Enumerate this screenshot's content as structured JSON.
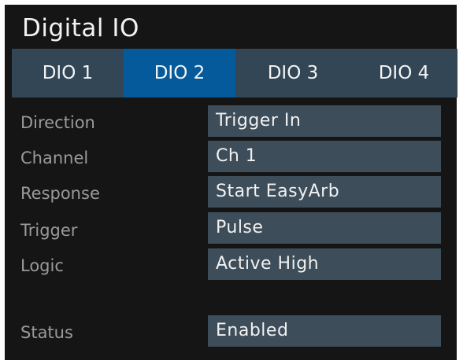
{
  "window": {
    "title": "Digital IO"
  },
  "tabs": [
    {
      "label": "DIO 1",
      "active": false
    },
    {
      "label": "DIO 2",
      "active": true
    },
    {
      "label": "DIO 3",
      "active": false
    },
    {
      "label": "DIO 4",
      "active": false
    }
  ],
  "settings": {
    "direction": {
      "label": "Direction",
      "value": "Trigger In"
    },
    "channel": {
      "label": "Channel",
      "value": "Ch 1"
    },
    "response": {
      "label": "Response",
      "value": "Start EasyArb"
    },
    "trigger": {
      "label": "Trigger",
      "value": "Pulse"
    },
    "logic": {
      "label": "Logic",
      "value": "Active High"
    },
    "status": {
      "label": "Status",
      "value": "Enabled"
    }
  },
  "colors": {
    "panel_background": "#151515",
    "tabbar_background": "#324656",
    "active_tab": "#045a9a",
    "field_background": "#3d4d59",
    "label_text": "#9a9a9a",
    "value_text": "#f1f1f1"
  }
}
